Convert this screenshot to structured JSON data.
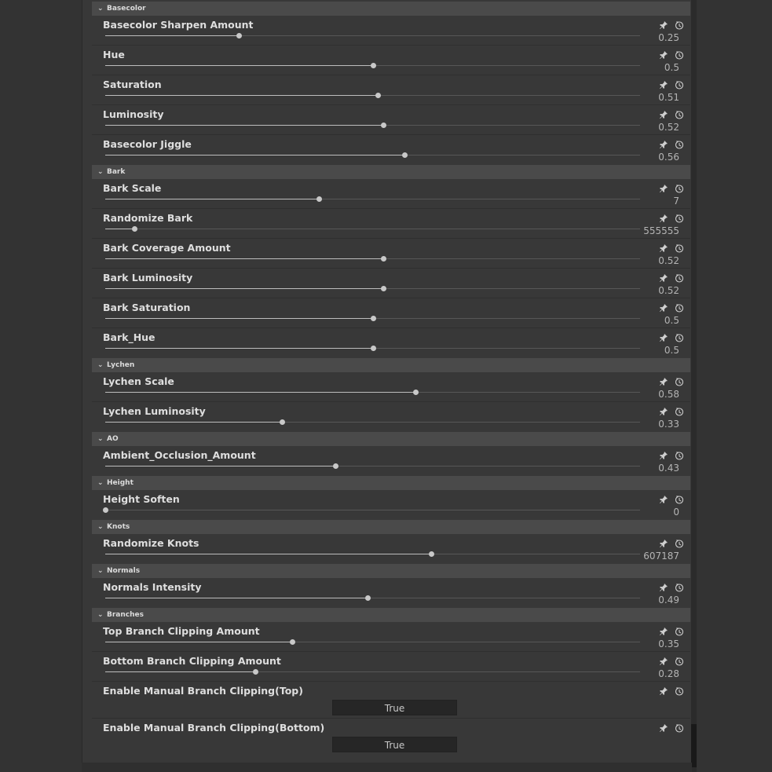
{
  "sections": [
    {
      "title": "Basecolor",
      "props": [
        {
          "label": "Basecolor  Sharpen Amount",
          "value": "0.25",
          "fraction": 0.25
        },
        {
          "label": "Hue",
          "value": "0.5",
          "fraction": 0.5
        },
        {
          "label": "Saturation",
          "value": "0.51",
          "fraction": 0.51
        },
        {
          "label": "Luminosity",
          "value": "0.52",
          "fraction": 0.52
        },
        {
          "label": "Basecolor Jiggle",
          "value": "0.56",
          "fraction": 0.56
        }
      ]
    },
    {
      "title": "Bark",
      "props": [
        {
          "label": "Bark Scale",
          "value": "7",
          "fraction": 0.4
        },
        {
          "label": "Randomize Bark",
          "value": "555555",
          "fraction": 0.055
        },
        {
          "label": "Bark Coverage Amount",
          "value": "0.52",
          "fraction": 0.52
        },
        {
          "label": "Bark Luminosity",
          "value": "0.52",
          "fraction": 0.52
        },
        {
          "label": "Bark Saturation",
          "value": "0.5",
          "fraction": 0.5
        },
        {
          "label": "Bark_Hue",
          "value": "0.5",
          "fraction": 0.5
        }
      ]
    },
    {
      "title": "Lychen",
      "props": [
        {
          "label": "Lychen Scale",
          "value": "0.58",
          "fraction": 0.58
        },
        {
          "label": "Lychen Luminosity",
          "value": "0.33",
          "fraction": 0.33
        }
      ]
    },
    {
      "title": "AO",
      "props": [
        {
          "label": "Ambient_Occlusion_Amount",
          "value": "0.43",
          "fraction": 0.43
        }
      ]
    },
    {
      "title": "Height",
      "props": [
        {
          "label": "Height Soften",
          "value": "0",
          "fraction": 0
        }
      ]
    },
    {
      "title": "Knots",
      "props": [
        {
          "label": "Randomize Knots",
          "value": "607187",
          "fraction": 0.61
        }
      ]
    },
    {
      "title": "Normals",
      "props": [
        {
          "label": "Normals Intensity",
          "value": "0.49",
          "fraction": 0.49
        }
      ]
    },
    {
      "title": "Branches",
      "props": [
        {
          "label": "Top Branch Clipping Amount",
          "value": "0.35",
          "fraction": 0.35
        },
        {
          "label": "Bottom Branch Clipping Amount",
          "value": "0.28",
          "fraction": 0.28
        },
        {
          "label": "Enable Manual Branch Clipping(Top)",
          "toggle": "True"
        },
        {
          "label": "Enable Manual Branch Clipping(Bottom)",
          "toggle": "True"
        }
      ]
    }
  ],
  "icons": {
    "pin": "pin-icon",
    "reset": "reset-icon"
  },
  "colors": {
    "panel": "#383838",
    "section_header": "#4a4a4a",
    "background": "#333333"
  }
}
